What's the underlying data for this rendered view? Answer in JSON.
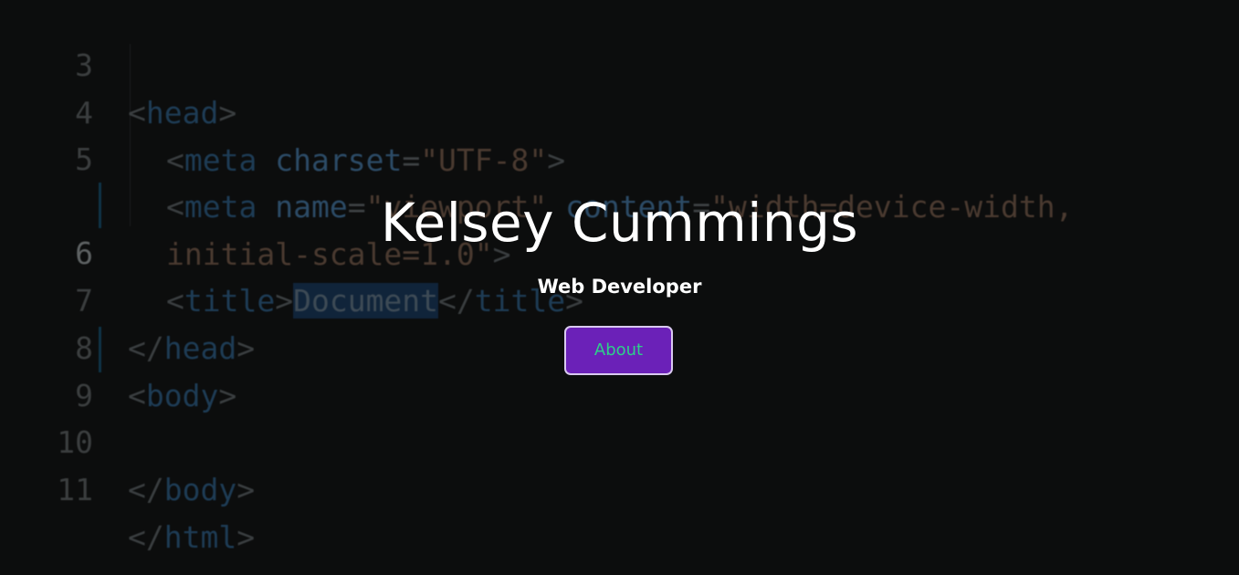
{
  "hero": {
    "name": "Kelsey Cummings",
    "subtitle": "Web Developer",
    "about_label": "About"
  },
  "background_code": {
    "lines": [
      {
        "number": "3",
        "code": "<head>"
      },
      {
        "number": "4",
        "code": "<meta charset=\"UTF-8\">"
      },
      {
        "number": "5",
        "code": "<meta name=\"viewport\" content=\"width=device-width,"
      },
      {
        "number": "",
        "code": "initial-scale=1.0\">"
      },
      {
        "number": "6",
        "code": "<title>Document</title>"
      },
      {
        "number": "7",
        "code": "</head>"
      },
      {
        "number": "8",
        "code": "<body>"
      },
      {
        "number": "9",
        "code": ""
      },
      {
        "number": "10",
        "code": "</body>"
      },
      {
        "number": "11",
        "code": "</html>"
      }
    ]
  },
  "colors": {
    "background": "#0c0d0d",
    "button_bg": "#6b21b8",
    "button_text": "#2ecf8a",
    "button_border": "#d9c9ef",
    "heading_text": "#ffffff"
  }
}
